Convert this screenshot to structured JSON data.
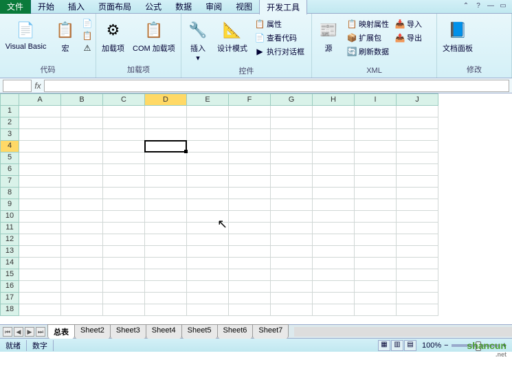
{
  "menu": {
    "file": "文件",
    "tabs": [
      "开始",
      "插入",
      "页面布局",
      "公式",
      "数据",
      "审阅",
      "视图",
      "开发工具"
    ],
    "active_index": 7
  },
  "ribbon": {
    "groups": [
      {
        "label": "代码",
        "items": [
          {
            "label": "Visual Basic",
            "icon": "📄"
          },
          {
            "label": "宏",
            "icon": "📋"
          }
        ],
        "small": [
          "📄",
          "📋",
          "⚠"
        ]
      },
      {
        "label": "加载项",
        "items": [
          {
            "label": "加载项",
            "icon": "⚙"
          },
          {
            "label": "COM 加载项",
            "icon": "📋"
          }
        ]
      },
      {
        "label": "控件",
        "items": [
          {
            "label": "插入",
            "icon": "🔧"
          },
          {
            "label": "设计模式",
            "icon": "📐"
          }
        ],
        "rows": [
          "属性",
          "查看代码",
          "执行对话框"
        ]
      },
      {
        "label": "XML",
        "items": [
          {
            "label": "源",
            "icon": "📰"
          }
        ],
        "rows": [
          "映射属性",
          "扩展包",
          "刷新数据"
        ],
        "rows2": [
          "导入",
          "导出"
        ]
      },
      {
        "label": "修改",
        "items": [
          {
            "label": "文档面板",
            "icon": "📘"
          }
        ]
      }
    ]
  },
  "formula": {
    "fx": "fx",
    "name": "",
    "value": ""
  },
  "grid": {
    "cols": [
      "A",
      "B",
      "C",
      "D",
      "E",
      "F",
      "G",
      "H",
      "I",
      "J"
    ],
    "rows": 18,
    "sel_col": "D",
    "sel_row": 4,
    "sel_col_index": 3,
    "sel_row_index": 3
  },
  "sheets": {
    "tabs": [
      "总表",
      "Sheet2",
      "Sheet3",
      "Sheet4",
      "Sheet5",
      "Sheet6",
      "Sheet7"
    ],
    "active": 0
  },
  "status": {
    "ready": "就绪",
    "mode": "数字",
    "zoom": "100%",
    "zoom_minus": "−",
    "zoom_plus": "+"
  },
  "watermark": {
    "main": "shancun",
    "sub": ".net"
  }
}
